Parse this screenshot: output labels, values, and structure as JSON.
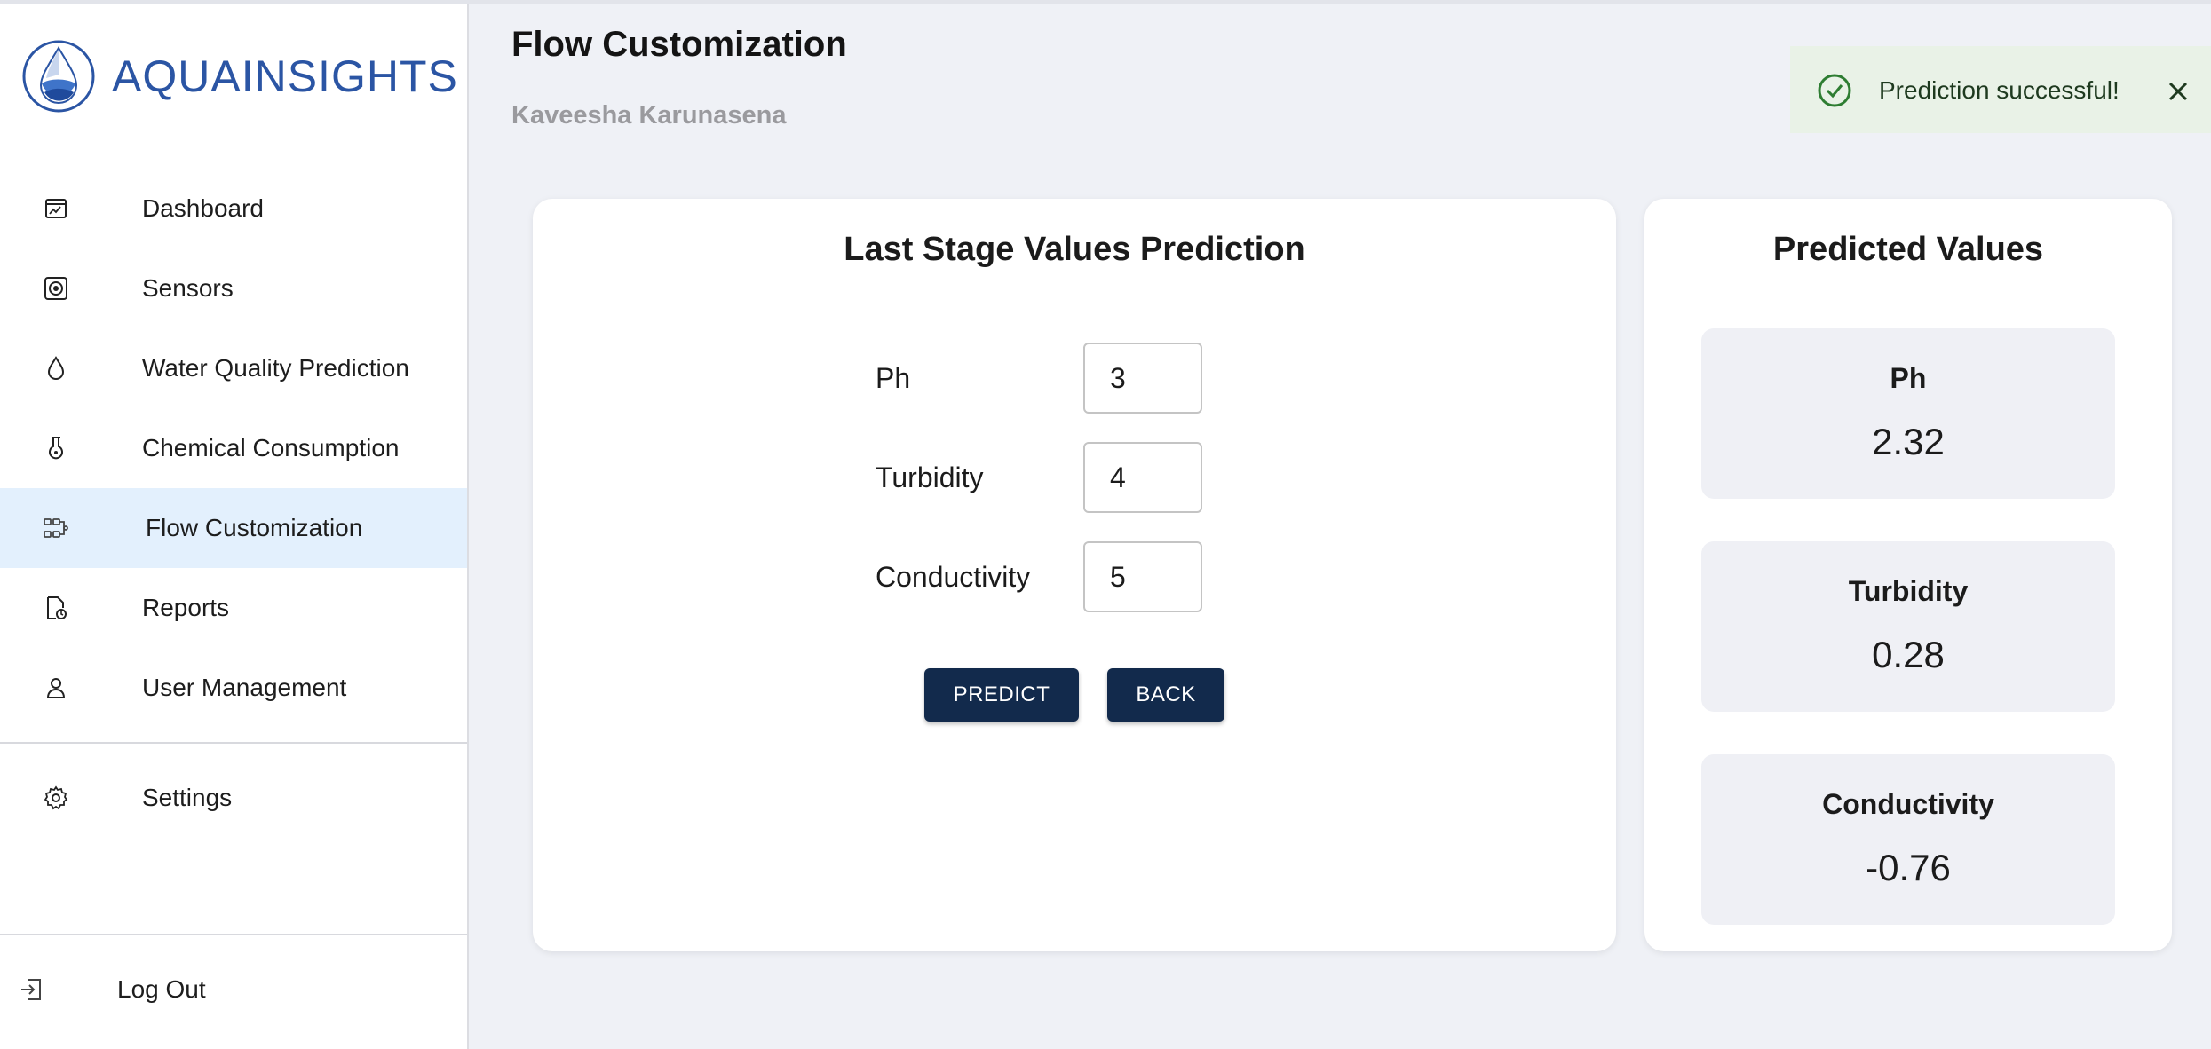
{
  "app": {
    "brand": "AQUAINSIGHTS"
  },
  "sidebar": {
    "items": [
      {
        "label": "Dashboard",
        "icon": "dashboard-icon"
      },
      {
        "label": "Sensors",
        "icon": "sensor-icon"
      },
      {
        "label": "Water Quality Prediction",
        "icon": "water-drop-icon"
      },
      {
        "label": "Chemical Consumption",
        "icon": "flask-icon"
      },
      {
        "label": "Flow Customization",
        "icon": "flow-icon",
        "active": true
      },
      {
        "label": "Reports",
        "icon": "report-icon"
      },
      {
        "label": "User Management",
        "icon": "user-icon"
      }
    ],
    "settings": {
      "label": "Settings",
      "icon": "gear-icon"
    },
    "logout": {
      "label": "Log Out",
      "icon": "logout-icon"
    }
  },
  "header": {
    "title": "Flow Customization",
    "user": "Kaveesha Karunasena"
  },
  "toast": {
    "message": "Prediction successful!",
    "icon": "check-circle-icon"
  },
  "form": {
    "title": "Last Stage Values Prediction",
    "fields": [
      {
        "label": "Ph",
        "value": "3"
      },
      {
        "label": "Turbidity",
        "value": "4"
      },
      {
        "label": "Conductivity",
        "value": "5"
      }
    ],
    "predict_label": "PREDICT",
    "back_label": "BACK"
  },
  "results": {
    "title": "Predicted Values",
    "items": [
      {
        "label": "Ph",
        "value": "2.32"
      },
      {
        "label": "Turbidity",
        "value": "0.28"
      },
      {
        "label": "Conductivity",
        "value": "-0.76"
      }
    ]
  },
  "colors": {
    "brand": "#2b55a4",
    "button": "#122a4c",
    "active_nav": "#e3f0fd",
    "toast_bg": "#e9f2e7",
    "toast_icon": "#2e7d32"
  }
}
